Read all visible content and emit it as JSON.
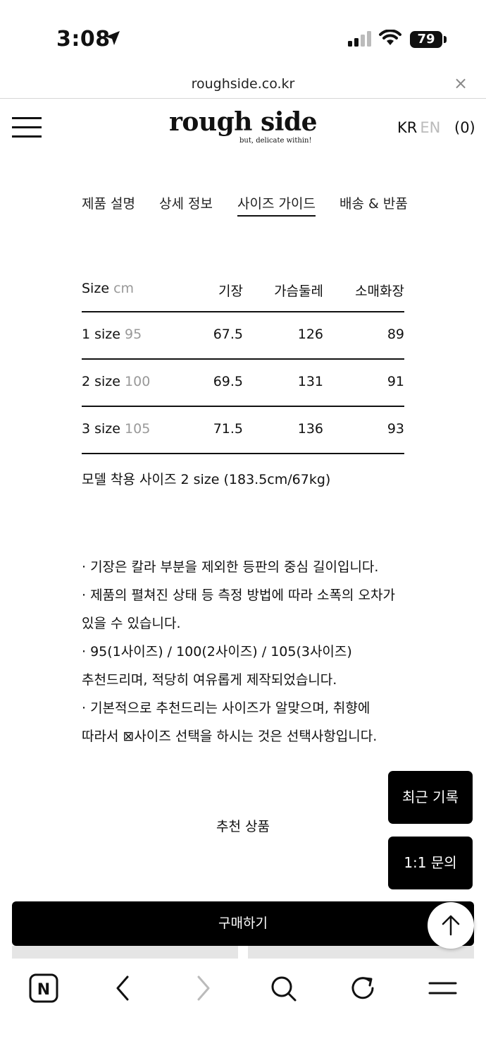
{
  "status_bar": {
    "time": "3:08",
    "battery": "79"
  },
  "browser": {
    "url": "roughside.co.kr",
    "close_glyph": "×"
  },
  "header": {
    "logo": "rough side",
    "tagline": "but, delicate within!",
    "lang_kr": "KR",
    "lang_en": "EN",
    "cart": "(0)"
  },
  "tabs": [
    {
      "label": "제품 설명"
    },
    {
      "label": "상세 정보"
    },
    {
      "label": "사이즈 가이드"
    },
    {
      "label": "배송 & 반품"
    }
  ],
  "size_table": {
    "headers": {
      "size": "Size",
      "unit": "cm",
      "length": "기장",
      "chest": "가슴둘레",
      "sleeve": "소매화장"
    },
    "rows": [
      {
        "size": "1 size",
        "equiv": "95",
        "length": "67.5",
        "chest": "126",
        "sleeve": "89"
      },
      {
        "size": "2 size",
        "equiv": "100",
        "length": "69.5",
        "chest": "131",
        "sleeve": "91"
      },
      {
        "size": "3 size",
        "equiv": "105",
        "length": "71.5",
        "chest": "136",
        "sleeve": "93"
      }
    ]
  },
  "model_note": "모델 착용 사이즈 2 size (183.5cm/67kg)",
  "notes": [
    "· 기장은 칼라 부분을 제외한 등판의 중심 길이입니다.",
    "· 제품의 펼쳐진 상태 등 측정 방법에 따라 소폭의 오차가",
    "있을 수 있습니다.",
    "· 95(1사이즈) / 100(2사이즈) / 105(3사이즈)",
    "추천드리며, 적당히 여유롭게 제작되었습니다.",
    "· 기본적으로 추천드리는 사이즈가 알맞으며, 취향에",
    "따라서 ⊠사이즈 선택을 하시는 것은 선택사항입니다."
  ],
  "recommended_title": "추천 상품",
  "floating": {
    "recent": "최근 기록",
    "inquiry": "1:1 문의"
  },
  "buy_button": "구매하기",
  "toolbar": {
    "home_label": "N"
  }
}
